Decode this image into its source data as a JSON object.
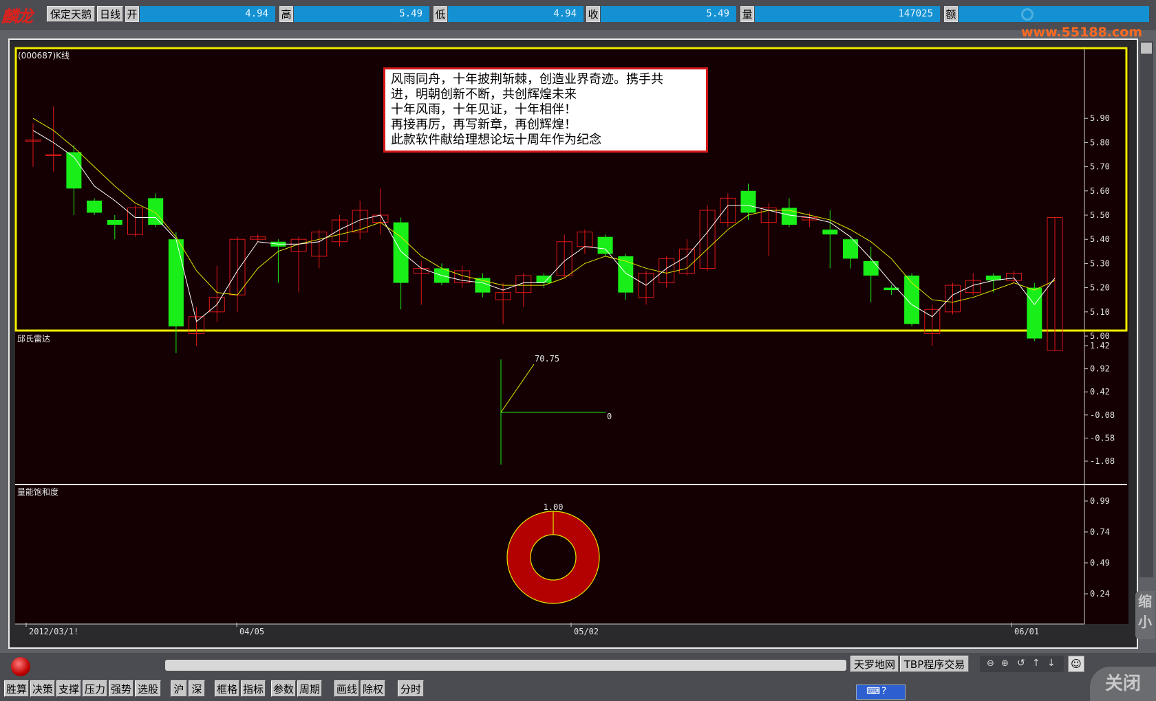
{
  "header": {
    "logo": "麟龙",
    "stock_name": "保定天鹅",
    "period": "日线",
    "fields": [
      {
        "label": "开",
        "value": "4.94"
      },
      {
        "label": "高",
        "value": "5.49"
      },
      {
        "label": "低",
        "value": "4.94"
      },
      {
        "label": "收",
        "value": "5.49"
      },
      {
        "label": "量",
        "value": "147025"
      },
      {
        "label": "额",
        "value": ""
      }
    ],
    "watermark": "www.55188.com"
  },
  "kline": {
    "title": "(000687)K线",
    "y_ticks": [
      "5.90",
      "5.80",
      "5.70",
      "5.60",
      "5.50",
      "5.40",
      "5.30",
      "5.20",
      "5.10",
      "5.00"
    ],
    "notice_lines": [
      "风雨同舟，十年披荆斩棘，创造业界奇迹。携手共",
      "进，明朝创新不断，共创辉煌未来",
      "十年风雨，十年见证，十年相伴！",
      "再接再厉，再写新章，再创辉煌！",
      "此款软件献给理想论坛十周年作为纪念"
    ]
  },
  "radar": {
    "title": "邱氏雷达",
    "value_label": "70.75",
    "zero_label": "0",
    "y_ticks": [
      "1.42",
      "0.92",
      "0.42",
      "-0.08",
      "-0.58",
      "-1.08"
    ]
  },
  "energy": {
    "title": "量能饱和度",
    "value_label": "1.00",
    "y_ticks": [
      "0.99",
      "0.74",
      "0.49",
      "0.24"
    ]
  },
  "x_axis": {
    "labels": [
      "2012/03/1!",
      "04/05",
      "05/02",
      "06/01"
    ]
  },
  "side": {
    "shrink": "缩小",
    "close": "关闭"
  },
  "right_buttons": [
    "天罗地网",
    "TBP程序交易"
  ],
  "bottom_buttons": [
    "胜算",
    "决策",
    "支撑",
    "压力",
    "强势",
    "选股",
    "沪",
    "深",
    "框格",
    "指标",
    "参数",
    "周期",
    "画线",
    "除权",
    "分时"
  ],
  "colors": {
    "up": "#e01818",
    "down": "#19ee19",
    "ma_white": "#ffffff",
    "ma_yellow": "#e6e600",
    "frame_yellow": "#f4ef00",
    "ring": "#b30000"
  },
  "chart_data": {
    "type": "candlestick",
    "price_range": [
      4.93,
      5.97
    ],
    "candles": [
      {
        "o": 5.81,
        "c": 5.81,
        "h": 5.88,
        "l": 5.7
      },
      {
        "o": 5.75,
        "c": 5.75,
        "h": 5.95,
        "l": 5.68
      },
      {
        "o": 5.76,
        "c": 5.61,
        "h": 5.79,
        "l": 5.5
      },
      {
        "o": 5.56,
        "c": 5.51,
        "h": 5.57,
        "l": 5.5
      },
      {
        "o": 5.48,
        "c": 5.46,
        "h": 5.5,
        "l": 5.4
      },
      {
        "o": 5.42,
        "c": 5.53,
        "h": 5.54,
        "l": 5.41
      },
      {
        "o": 5.57,
        "c": 5.46,
        "h": 5.59,
        "l": 5.45
      },
      {
        "o": 5.4,
        "c": 5.04,
        "h": 5.43,
        "l": 4.93
      },
      {
        "o": 5.01,
        "c": 5.08,
        "h": 5.12,
        "l": 4.96
      },
      {
        "o": 5.1,
        "c": 5.16,
        "h": 5.29,
        "l": 5.06
      },
      {
        "o": 5.17,
        "c": 5.4,
        "h": 5.41,
        "l": 5.1
      },
      {
        "o": 5.4,
        "c": 5.41,
        "h": 5.42,
        "l": 5.39
      },
      {
        "o": 5.39,
        "c": 5.37,
        "h": 5.4,
        "l": 5.22
      },
      {
        "o": 5.35,
        "c": 5.4,
        "h": 5.41,
        "l": 5.18
      },
      {
        "o": 5.33,
        "c": 5.43,
        "h": 5.44,
        "l": 5.28
      },
      {
        "o": 5.39,
        "c": 5.48,
        "h": 5.5,
        "l": 5.37
      },
      {
        "o": 5.43,
        "c": 5.52,
        "h": 5.56,
        "l": 5.4
      },
      {
        "o": 5.47,
        "c": 5.5,
        "h": 5.61,
        "l": 5.42
      },
      {
        "o": 5.47,
        "c": 5.22,
        "h": 5.49,
        "l": 5.11
      },
      {
        "o": 5.26,
        "c": 5.28,
        "h": 5.31,
        "l": 5.13
      },
      {
        "o": 5.28,
        "c": 5.22,
        "h": 5.3,
        "l": 5.21
      },
      {
        "o": 5.22,
        "c": 5.27,
        "h": 5.29,
        "l": 5.2
      },
      {
        "o": 5.24,
        "c": 5.18,
        "h": 5.26,
        "l": 5.16
      },
      {
        "o": 5.15,
        "c": 5.18,
        "h": 5.22,
        "l": 5.05
      },
      {
        "o": 5.18,
        "c": 5.25,
        "h": 5.26,
        "l": 5.12
      },
      {
        "o": 5.25,
        "c": 5.22,
        "h": 5.26,
        "l": 5.2
      },
      {
        "o": 5.25,
        "c": 5.39,
        "h": 5.42,
        "l": 5.24
      },
      {
        "o": 5.37,
        "c": 5.43,
        "h": 5.44,
        "l": 5.34
      },
      {
        "o": 5.41,
        "c": 5.34,
        "h": 5.42,
        "l": 5.33
      },
      {
        "o": 5.33,
        "c": 5.18,
        "h": 5.34,
        "l": 5.15
      },
      {
        "o": 5.16,
        "c": 5.26,
        "h": 5.27,
        "l": 5.13
      },
      {
        "o": 5.22,
        "c": 5.32,
        "h": 5.33,
        "l": 5.2
      },
      {
        "o": 5.26,
        "c": 5.36,
        "h": 5.4,
        "l": 5.25
      },
      {
        "o": 5.28,
        "c": 5.52,
        "h": 5.54,
        "l": 5.27
      },
      {
        "o": 5.47,
        "c": 5.57,
        "h": 5.59,
        "l": 5.45
      },
      {
        "o": 5.6,
        "c": 5.51,
        "h": 5.63,
        "l": 5.48
      },
      {
        "o": 5.47,
        "c": 5.53,
        "h": 5.55,
        "l": 5.33
      },
      {
        "o": 5.53,
        "c": 5.46,
        "h": 5.57,
        "l": 5.45
      },
      {
        "o": 5.48,
        "c": 5.49,
        "h": 5.51,
        "l": 5.45
      },
      {
        "o": 5.44,
        "c": 5.42,
        "h": 5.52,
        "l": 5.28
      },
      {
        "o": 5.4,
        "c": 5.32,
        "h": 5.41,
        "l": 5.28
      },
      {
        "o": 5.31,
        "c": 5.25,
        "h": 5.37,
        "l": 5.14
      },
      {
        "o": 5.2,
        "c": 5.19,
        "h": 5.21,
        "l": 5.17
      },
      {
        "o": 5.25,
        "c": 5.05,
        "h": 5.26,
        "l": 5.04
      },
      {
        "o": 5.01,
        "c": 5.11,
        "h": 5.13,
        "l": 4.96
      },
      {
        "o": 5.1,
        "c": 5.21,
        "h": 5.22,
        "l": 5.09
      },
      {
        "o": 5.18,
        "c": 5.23,
        "h": 5.26,
        "l": 5.17
      },
      {
        "o": 5.25,
        "c": 5.23,
        "h": 5.26,
        "l": 5.18
      },
      {
        "o": 5.23,
        "c": 5.26,
        "h": 5.27,
        "l": 5.22
      },
      {
        "o": 5.2,
        "c": 4.99,
        "h": 5.22,
        "l": 4.98
      },
      {
        "o": 4.94,
        "c": 5.49,
        "h": 5.49,
        "l": 4.94
      }
    ],
    "ma_white": [
      5.85,
      5.8,
      5.74,
      5.62,
      5.56,
      5.49,
      5.49,
      5.4,
      5.06,
      5.13,
      5.27,
      5.39,
      5.38,
      5.38,
      5.39,
      5.44,
      5.48,
      5.5,
      5.35,
      5.28,
      5.25,
      5.23,
      5.22,
      5.19,
      5.22,
      5.22,
      5.31,
      5.37,
      5.36,
      5.26,
      5.21,
      5.28,
      5.33,
      5.43,
      5.54,
      5.54,
      5.52,
      5.5,
      5.49,
      5.47,
      5.41,
      5.32,
      5.22,
      5.13,
      5.08,
      5.17,
      5.21,
      5.23,
      5.24,
      5.13,
      5.24
    ],
    "ma_yellow": [
      5.9,
      5.85,
      5.78,
      5.7,
      5.62,
      5.55,
      5.51,
      5.41,
      5.27,
      5.18,
      5.17,
      5.28,
      5.35,
      5.38,
      5.4,
      5.42,
      5.44,
      5.47,
      5.41,
      5.33,
      5.28,
      5.25,
      5.23,
      5.21,
      5.21,
      5.21,
      5.24,
      5.3,
      5.33,
      5.31,
      5.28,
      5.26,
      5.28,
      5.36,
      5.44,
      5.5,
      5.52,
      5.52,
      5.5,
      5.48,
      5.44,
      5.39,
      5.32,
      5.22,
      5.15,
      5.14,
      5.16,
      5.19,
      5.22,
      5.19,
      5.23
    ],
    "x_tick_labels": [
      "2012/03/1!",
      "04/05",
      "05/02",
      "06/01"
    ],
    "radar_value": 70.75,
    "energy_value": 1.0
  }
}
